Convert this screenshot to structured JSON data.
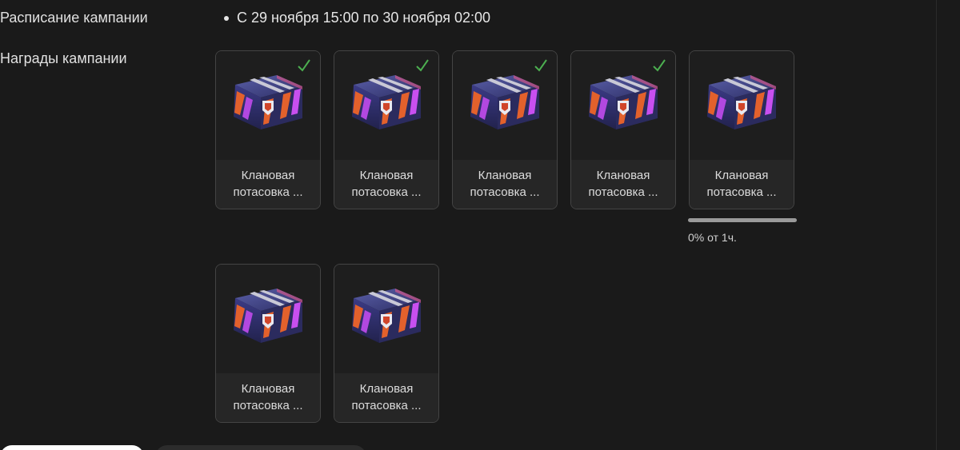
{
  "campaign": {
    "schedule_label": "Расписание кампании",
    "schedule_value": "С 29 ноября 15:00 по 30 ноября 02:00",
    "rewards_label": "Награды кампании"
  },
  "rewards": [
    {
      "line1": "Клановая",
      "line2": "потасовка ...",
      "claimed": true
    },
    {
      "line1": "Клановая",
      "line2": "потасовка ...",
      "claimed": true
    },
    {
      "line1": "Клановая",
      "line2": "потасовка ...",
      "claimed": true
    },
    {
      "line1": "Клановая",
      "line2": "потасовка ...",
      "claimed": true
    },
    {
      "line1": "Клановая",
      "line2": "потасовка ...",
      "claimed": false
    },
    {
      "line1": "Клановая",
      "line2": "потасовка ...",
      "claimed": false
    },
    {
      "line1": "Клановая",
      "line2": "потасовка ...",
      "claimed": false
    }
  ],
  "progress": {
    "percent": 0,
    "text": "0% от 1ч."
  },
  "colors": {
    "check": "#4caf50",
    "card_border": "#444444",
    "background": "#1a1a1a"
  }
}
